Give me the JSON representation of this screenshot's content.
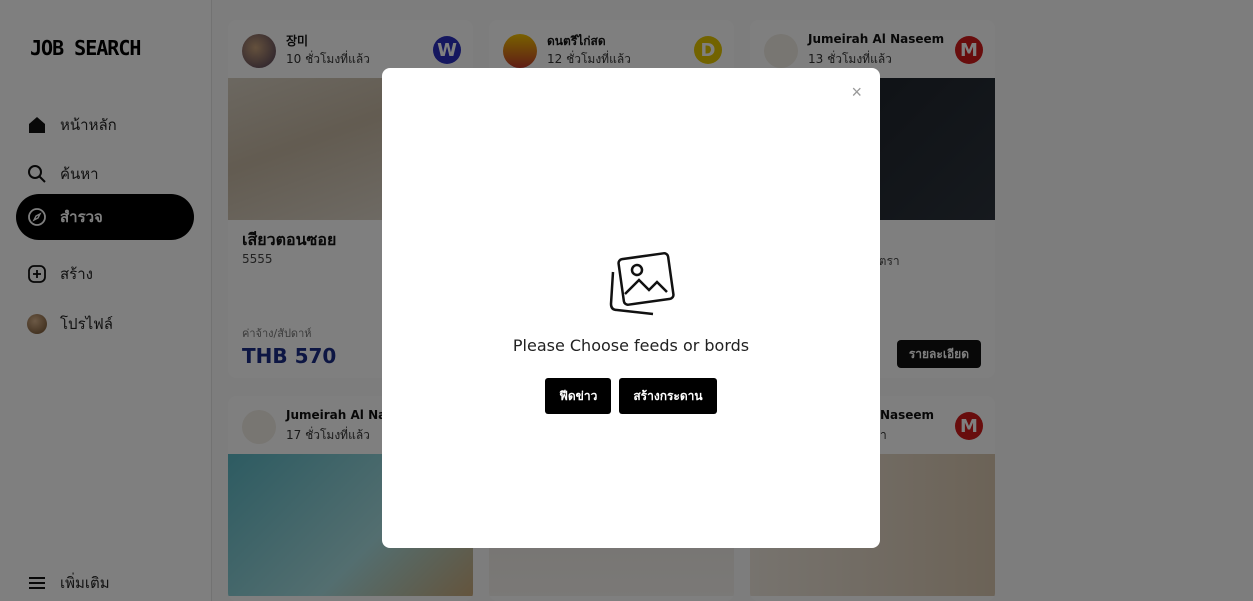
{
  "app": {
    "logo": "JOB SEARCH"
  },
  "nav": {
    "home": "หน้าหลัก",
    "search": "ค้นหา",
    "explore": "สำรวจ",
    "create": "สร้าง",
    "profile": "โปรไฟล์",
    "more": "เพิ่มเติม"
  },
  "cards": [
    {
      "name": "장미",
      "time": "10 ชั่วโมงที่แล้ว",
      "badge": "W",
      "badge_color": "#2a2fbf"
    },
    {
      "name": "ดนตรีไก่สด",
      "time": "12 ชั่วโมงที่แล้ว",
      "badge": "D",
      "badge_color": "#e5c700"
    },
    {
      "name": "Jumeirah Al Naseem",
      "time": "13 ชั่วโมงที่แล้ว",
      "badge": "M",
      "badge_color": "#d11a1a",
      "desc": "3 อัตรา",
      "button": "รายละเอียด"
    },
    {
      "name": "Jumeirah Al Na",
      "time": "17 ชั่วโมงที่แล้ว"
    },
    {
      "name": "Naseem",
      "time": "า",
      "badge": "M",
      "badge_color": "#d11a1a"
    }
  ],
  "card1": {
    "title": "เสียวตอนซอย",
    "desc": "5555",
    "price_label": "ค่าจ้าง/สัปดาห์",
    "price": "THB 570"
  },
  "modal": {
    "close": "×",
    "message": "Please Choose feeds or bords",
    "btn_feed": "ฟีดข่าว",
    "btn_board": "สร้างกระดาน"
  }
}
